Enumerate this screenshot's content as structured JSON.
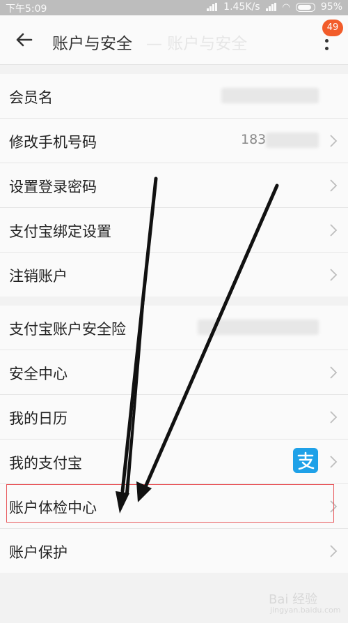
{
  "status_bar": {
    "time": "下午5:09",
    "speed": "1.45K/s",
    "battery": "95%"
  },
  "header": {
    "title": "账户与安全",
    "ghost_title": "— 账户与安全",
    "badge": "49"
  },
  "groups": [
    {
      "items": [
        {
          "label": "会员名"
        },
        {
          "label": "修改手机号码",
          "value": "183"
        },
        {
          "label": "设置登录密码"
        },
        {
          "label": "支付宝绑定设置"
        },
        {
          "label": "注销账户"
        }
      ]
    },
    {
      "items": [
        {
          "label": "支付宝账户安全险"
        },
        {
          "label": "安全中心"
        },
        {
          "label": "我的日历"
        },
        {
          "label": "我的支付宝"
        },
        {
          "label": "账户体检中心"
        },
        {
          "label": "账户保护"
        }
      ]
    }
  ],
  "icons": {
    "back": "back-arrow-icon",
    "menu": "more-vert-icon",
    "alipay": "alipay-icon",
    "chevron": "chevron-right-icon"
  },
  "colors": {
    "badge": "#f25c2a",
    "alipay": "#1fa1e8",
    "highlight_border": "#e8585c"
  },
  "watermark": {
    "text": "Bai 经验",
    "sub": "jingyan.baidu.com"
  }
}
